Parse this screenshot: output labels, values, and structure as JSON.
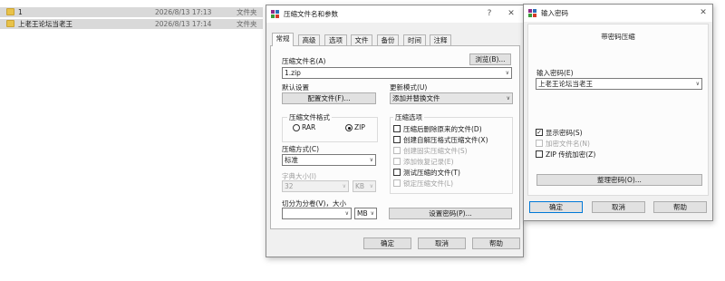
{
  "explorer": {
    "rows": [
      {
        "name": "1",
        "date": "2026/8/13 17:13",
        "type": "文件夹"
      },
      {
        "name": "上老王论坛当老王",
        "date": "2026/8/13 17:14",
        "type": "文件夹"
      }
    ]
  },
  "archive_dialog": {
    "title": "压缩文件名和参数",
    "help_btn": "?",
    "close_btn": "✕",
    "tabs": [
      "常规",
      "高级",
      "选项",
      "文件",
      "备份",
      "时间",
      "注释"
    ],
    "archive_name_label": "压缩文件名(A)",
    "browse_button": "浏览(B)...",
    "archive_name_value": "1.zip",
    "default_profile_label": "默认设置",
    "profiles_button": "配置文件(F)...",
    "update_mode_label": "更新模式(U)",
    "update_mode_value": "添加并替换文件",
    "format_group": "压缩文件格式",
    "format_rar": "RAR",
    "format_zip": "ZIP",
    "selected_format": "ZIP",
    "options_group": "压缩选项",
    "options": [
      {
        "label": "压缩后删除原来的文件(D)",
        "checked": false,
        "enabled": true
      },
      {
        "label": "创建自解压格式压缩文件(X)",
        "checked": false,
        "enabled": true
      },
      {
        "label": "创建固实压缩文件(S)",
        "checked": false,
        "enabled": false
      },
      {
        "label": "添加恢复记录(E)",
        "checked": false,
        "enabled": false
      },
      {
        "label": "测试压缩的文件(T)",
        "checked": false,
        "enabled": true
      },
      {
        "label": "锁定压缩文件(L)",
        "checked": false,
        "enabled": false
      }
    ],
    "method_label": "压缩方式(C)",
    "method_value": "标准",
    "dict_label": "字典大小(I)",
    "dict_value": "32",
    "dict_unit": "KB",
    "split_label": "切分为分卷(V)，大小",
    "split_value": "",
    "split_unit": "MB",
    "set_password_button": "设置密码(P)...",
    "ok": "确定",
    "cancel": "取消",
    "help": "帮助"
  },
  "password_dialog": {
    "title": "输入密码",
    "close_btn": "✕",
    "heading": "带密码压缩",
    "enter_label": "输入密码(E)",
    "password_value": "上老王论坛当老王",
    "show_password": {
      "label": "显示密码(S)",
      "checked": true,
      "enabled": true
    },
    "encrypt_names": {
      "label": "加密文件名(N)",
      "checked": false,
      "enabled": false
    },
    "zip_legacy": {
      "label": "ZIP 传统加密(Z)",
      "checked": false,
      "enabled": true
    },
    "organize_button": "整理密码(O)...",
    "ok": "确定",
    "cancel": "取消",
    "help": "帮助"
  },
  "colors": {
    "accent": "#0078d7",
    "folder": "#e8c24a"
  },
  "icons": {
    "app": "winrar-icon",
    "folder": "folder-icon",
    "dropdown": "chevron-down-icon"
  }
}
